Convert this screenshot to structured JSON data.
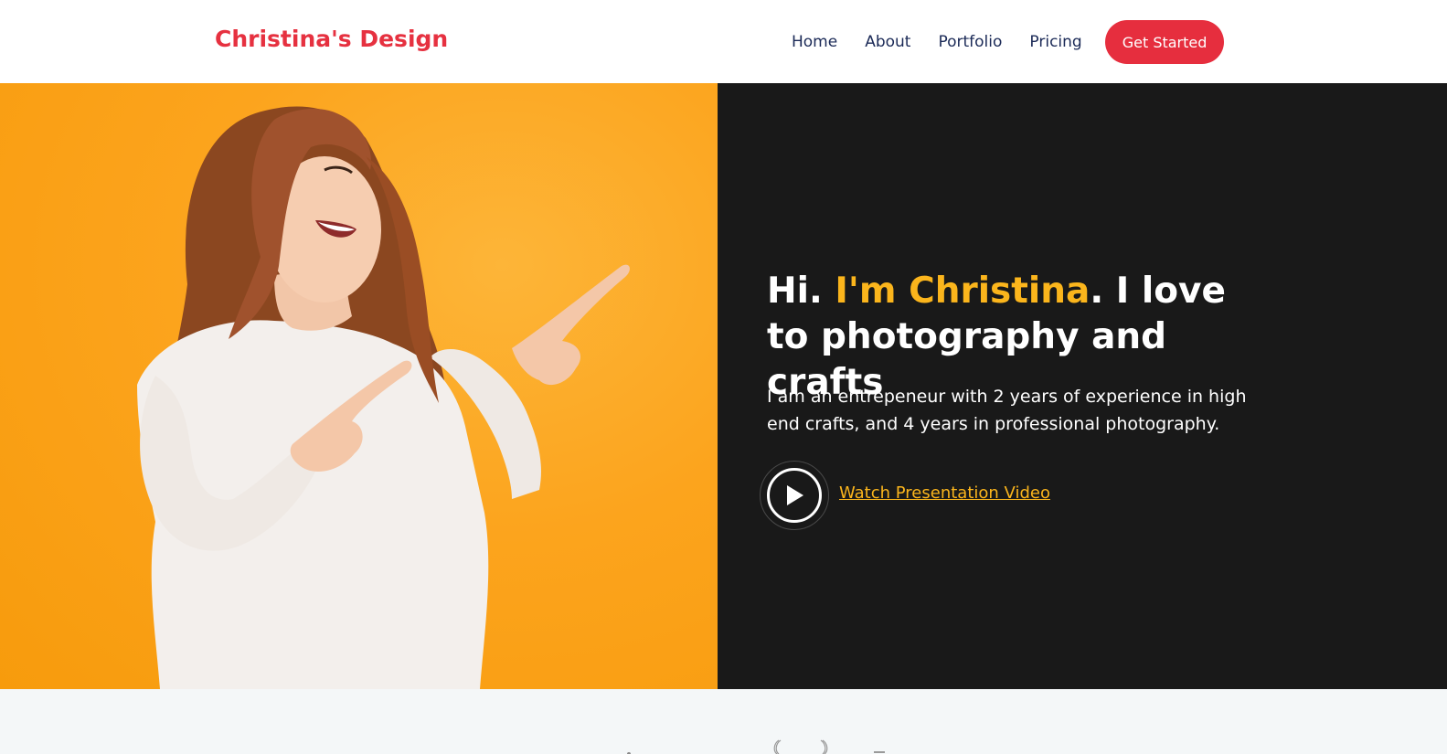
{
  "header": {
    "logo": "Christina's Design",
    "nav": [
      "Home",
      "About",
      "Portfolio",
      "Pricing"
    ],
    "cta_label": "Get Started"
  },
  "hero": {
    "headline_part1": "Hi. ",
    "headline_accent": "I'm Christina",
    "headline_part2": ". I love to photography and crafts",
    "intro": "I am an entrepeneur with 2 years of experience in high end crafts, and 4 years in professional photography.",
    "video_link": "Watch Presentation Video",
    "image_icon": "portrait-photo"
  },
  "colors": {
    "brand_red": "#e62e3e",
    "accent_yellow": "#fbb51c",
    "nav_text": "#1b2a57",
    "dark_panel": "#191919",
    "photo_bg": "#fca41d"
  }
}
